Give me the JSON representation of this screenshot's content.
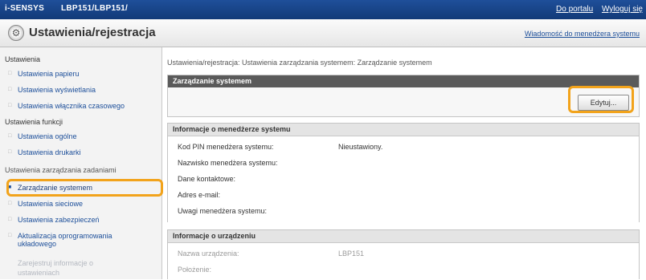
{
  "topbar": {
    "brand": "i-SENSYS",
    "model": "LBP151/LBP151/",
    "link_portal": "Do portalu",
    "link_logout": "Wyloguj się"
  },
  "titlebar": {
    "title": "Ustawienia/rejestracja",
    "admin_message": "Wiadomość do menedżera systemu"
  },
  "sidebar": {
    "sec1": "Ustawienia",
    "item_paper": "Ustawienia papieru",
    "item_display": "Ustawienia wyświetlania",
    "item_timer": "Ustawienia włącznika czasowego",
    "sec2": "Ustawienia funkcji",
    "item_general": "Ustawienia ogólne",
    "item_printer": "Ustawienia drukarki",
    "sec3": "Ustawienia zarządzania zadaniami",
    "item_system_mgmt": "Zarządzanie systemem",
    "item_network": "Ustawienia sieciowe",
    "item_security": "Ustawienia zabezpieczeń",
    "item_firmware_line1": "Aktualizacja oprogramowania",
    "item_firmware_line2": "układowego",
    "item_register_line1": "Zarejestruj informacje o",
    "item_register_line2": "ustawieniach"
  },
  "main": {
    "breadcrumb": "Ustawienia/rejestracja: Ustawienia zarządzania systemem: Zarządzanie systemem",
    "panel1_title": "Zarządzanie systemem",
    "edit_button": "Edytuj...",
    "panel2_title": "Informacje o menedżerze systemu",
    "pin_label": "Kod PIN menedżera systemu:",
    "pin_value": "Nieustawiony.",
    "name_label": "Nazwisko menedżera systemu:",
    "contact_label": "Dane kontaktowe:",
    "email_label": "Adres e-mail:",
    "comment_label": "Uwagi menedżera systemu:",
    "panel3_title": "Informacje o urządzeniu",
    "devname_label": "Nazwa urządzenia:",
    "devname_value": "LBP151",
    "location_label": "Położenie:"
  }
}
